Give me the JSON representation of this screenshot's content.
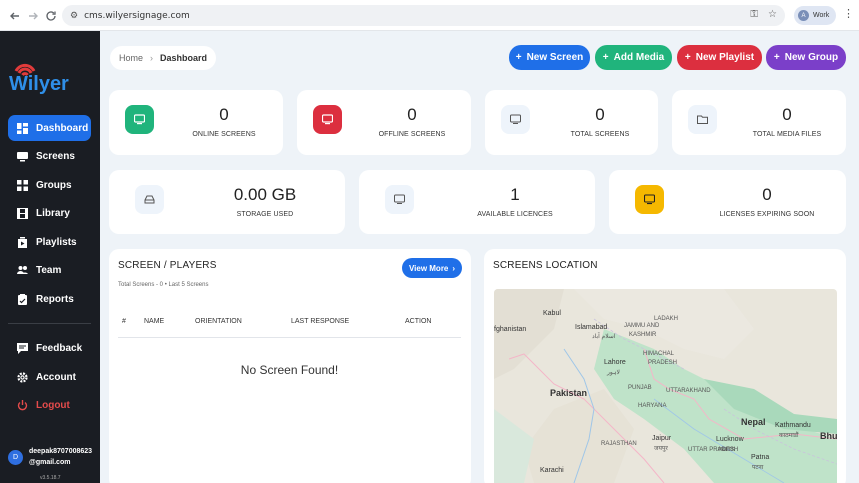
{
  "browser": {
    "url": "cms.wilyersignage.com",
    "profile_initial": "A",
    "profile_label": "Work"
  },
  "brand": {
    "logo_text": "Wilyer",
    "accent": "#1f6fe8",
    "logo_red": "#e23b3b"
  },
  "sidebar": {
    "items": [
      {
        "label": "Dashboard",
        "icon": "dashboard-icon",
        "active": true
      },
      {
        "label": "Screens",
        "icon": "monitor-icon"
      },
      {
        "label": "Groups",
        "icon": "grid-icon"
      },
      {
        "label": "Library",
        "icon": "film-icon"
      },
      {
        "label": "Playlists",
        "icon": "playlist-icon"
      },
      {
        "label": "Team",
        "icon": "team-icon"
      },
      {
        "label": "Reports",
        "icon": "report-icon"
      }
    ],
    "bottom_items": [
      {
        "label": "Feedback",
        "icon": "feedback-icon"
      },
      {
        "label": "Account",
        "icon": "gear-icon"
      },
      {
        "label": "Logout",
        "icon": "logout-icon",
        "color": "#e44b4b"
      }
    ],
    "user": {
      "initial": "D",
      "email_line1": "deepak8707008623",
      "email_line2": "@gmail.com",
      "version": "v3.5.18.7"
    }
  },
  "breadcrumb": {
    "home": "Home",
    "current": "Dashboard"
  },
  "actions": {
    "new_screen": {
      "label": "New Screen",
      "color": "#1f6fe8"
    },
    "add_media": {
      "label": "Add Media",
      "color": "#20b47c"
    },
    "new_playlist": {
      "label": "New Playlist",
      "color": "#dc2f3f"
    },
    "new_group": {
      "label": "New Group",
      "color": "#7b3fc9"
    }
  },
  "stats_row1": [
    {
      "value": "0",
      "label": "ONLINE SCREENS",
      "icon": "monitor-icon",
      "color": "#20b47c"
    },
    {
      "value": "0",
      "label": "OFFLINE SCREENS",
      "icon": "monitor-icon",
      "color": "#dc2f3f"
    },
    {
      "value": "0",
      "label": "TOTAL SCREENS",
      "icon": "monitor-icon",
      "color": "#eef4fb"
    },
    {
      "value": "0",
      "label": "TOTAL MEDIA FILES",
      "icon": "folder-icon",
      "color": "#eef4fb"
    }
  ],
  "stats_row2": [
    {
      "value": "0.00 GB",
      "label": "STORAGE USED",
      "icon": "storage-icon",
      "color": "#eef4fb"
    },
    {
      "value": "1",
      "label": "AVAILABLE LICENCES",
      "icon": "monitor-icon",
      "color": "#eef4fb"
    },
    {
      "value": "0",
      "label": "LICENSES EXPIRING SOON",
      "icon": "monitor-icon",
      "color": "#f5b800"
    }
  ],
  "players": {
    "title": "SCREEN / PLAYERS",
    "view_more": "View More",
    "subtitle": "Total Screens - 0  •  Last 5 Screens",
    "columns": [
      "#",
      "NAME",
      "ORIENTATION",
      "LAST RESPONSE",
      "ACTION"
    ],
    "empty": "No Screen Found!"
  },
  "location": {
    "title": "SCREENS LOCATION",
    "labels": [
      {
        "text": "fghanistan",
        "style": "n"
      },
      {
        "text": "Kabul",
        "style": "n"
      },
      {
        "text": "Islamabad",
        "style": "n"
      },
      {
        "text": "اسلام آباد",
        "style": "s"
      },
      {
        "text": "JAMMU AND",
        "style": "s"
      },
      {
        "text": "KASHMIR",
        "style": "s"
      },
      {
        "text": "LADAKH",
        "style": "s"
      },
      {
        "text": "HIMACHAL",
        "style": "s"
      },
      {
        "text": "PRADESH",
        "style": "s"
      },
      {
        "text": "Lahore",
        "style": "n"
      },
      {
        "text": "لاہور",
        "style": "s"
      },
      {
        "text": "PUNJAB",
        "style": "s"
      },
      {
        "text": "UTTARAKHAND",
        "style": "s"
      },
      {
        "text": "Pakistan",
        "style": "b"
      },
      {
        "text": "HARYANA",
        "style": "s"
      },
      {
        "text": "Nepal",
        "style": "b"
      },
      {
        "text": "Kathmandu",
        "style": "n"
      },
      {
        "text": "काठमाडौं",
        "style": "s"
      },
      {
        "text": "Lucknow",
        "style": "n"
      },
      {
        "text": "लखनऊ",
        "style": "s"
      },
      {
        "text": "Jaipur",
        "style": "n"
      },
      {
        "text": "जयपुर",
        "style": "s"
      },
      {
        "text": "RAJASTHAN",
        "style": "s"
      },
      {
        "text": "UTTAR PRADESH",
        "style": "s"
      },
      {
        "text": "Patna",
        "style": "n"
      },
      {
        "text": "पटना",
        "style": "s"
      },
      {
        "text": "Karachi",
        "style": "n"
      },
      {
        "text": "Bhu",
        "style": "b"
      }
    ]
  }
}
